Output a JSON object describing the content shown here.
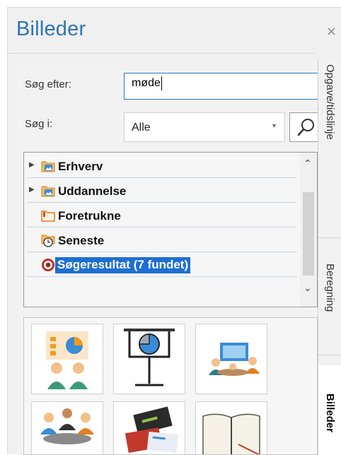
{
  "panel": {
    "title": "Billeder",
    "close_glyph": "×"
  },
  "search": {
    "label": "Søg efter:",
    "value": "møde",
    "scope_label": "Søg i:",
    "scope_value": "Alle",
    "search_icon": "magnifier-icon"
  },
  "tree": {
    "items": [
      {
        "label": "Erhverv",
        "icon": "folder-picture-icon",
        "expandable": true
      },
      {
        "label": "Uddannelse",
        "icon": "folder-picture-icon",
        "expandable": true
      },
      {
        "label": "Foretrukne",
        "icon": "favorites-folder-icon",
        "expandable": false
      },
      {
        "label": "Seneste",
        "icon": "recent-clock-icon",
        "expandable": false
      },
      {
        "label": "Søgeresultat (7 fundet)",
        "icon": "search-results-target-icon",
        "expandable": false,
        "selected": true
      }
    ]
  },
  "results": [
    {
      "name": "presentation-people-chart"
    },
    {
      "name": "projector-screen-pie-chart"
    },
    {
      "name": "meeting-room-screen"
    },
    {
      "name": "people-around-table"
    },
    {
      "name": "business-cards"
    },
    {
      "name": "open-notebook-pen"
    }
  ],
  "side_tabs": [
    {
      "label": "Opgave/tidslinje",
      "active": false
    },
    {
      "label": "Beregning",
      "active": false
    },
    {
      "label": "Billeder",
      "active": true
    }
  ],
  "colors": {
    "title": "#2e73b8",
    "selection": "#1e6fd1",
    "folder_blue": "#3b8bd6",
    "folder_orange": "#f39a1e"
  }
}
